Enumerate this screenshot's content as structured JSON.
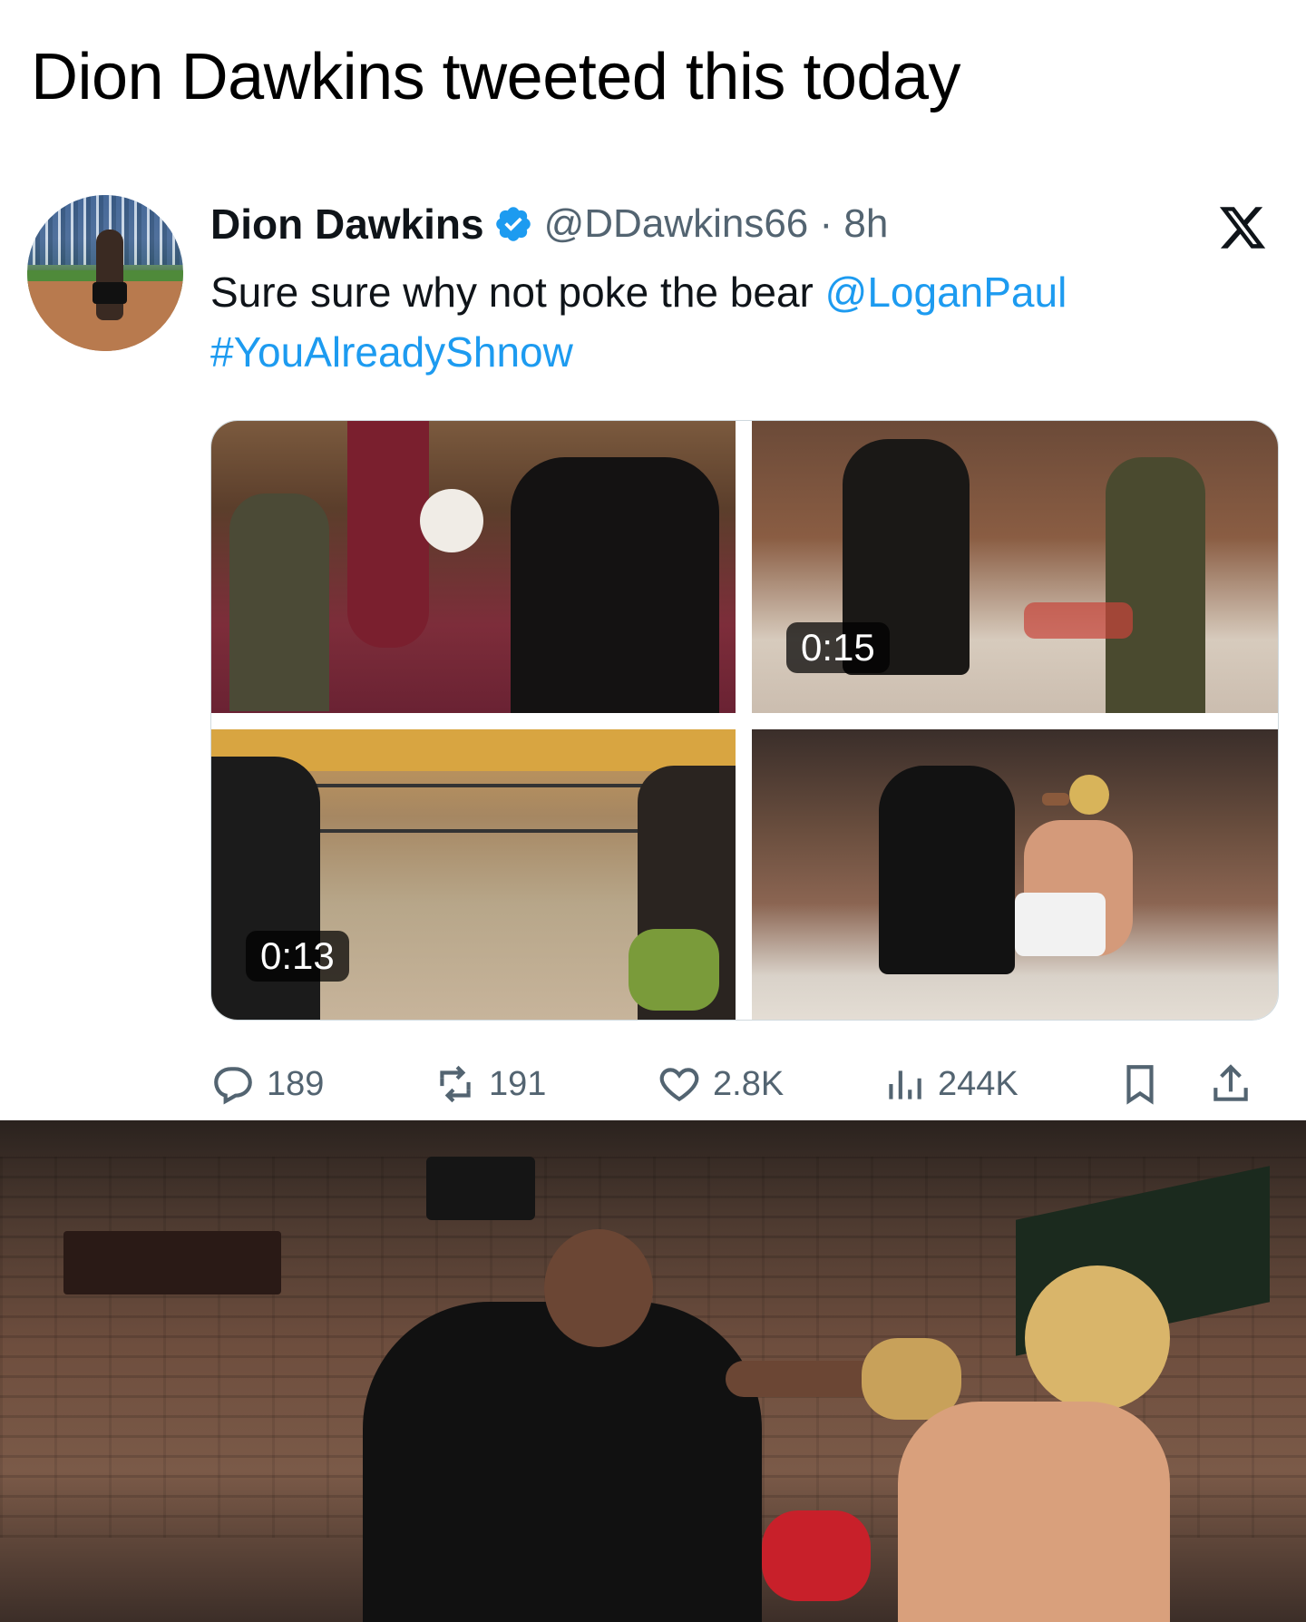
{
  "headline": "Dion Dawkins tweeted this today",
  "tweet": {
    "author_name": "Dion Dawkins",
    "handle_time": "@DDawkins66 · 8h",
    "text_before": "Sure sure why not poke the bear ",
    "mention": "@LoganPaul",
    "hashtag": "#YouAlreadyShnow",
    "media": [
      {
        "name": "video-1",
        "duration": ""
      },
      {
        "name": "video-2",
        "duration": "0:15"
      },
      {
        "name": "video-3",
        "duration": "0:13"
      },
      {
        "name": "photo-4",
        "duration": ""
      }
    ],
    "actions": {
      "replies": "189",
      "reposts": "191",
      "likes": "2.8K",
      "views": "244K"
    },
    "icons": [
      "verified-badge-icon",
      "x-logo-icon",
      "reply-icon",
      "repost-icon",
      "like-icon",
      "views-icon",
      "bookmark-icon",
      "share-icon"
    ]
  },
  "colors": {
    "link": "#1d9bf0",
    "secondary_text": "#536471",
    "primary_text": "#0f1419"
  }
}
